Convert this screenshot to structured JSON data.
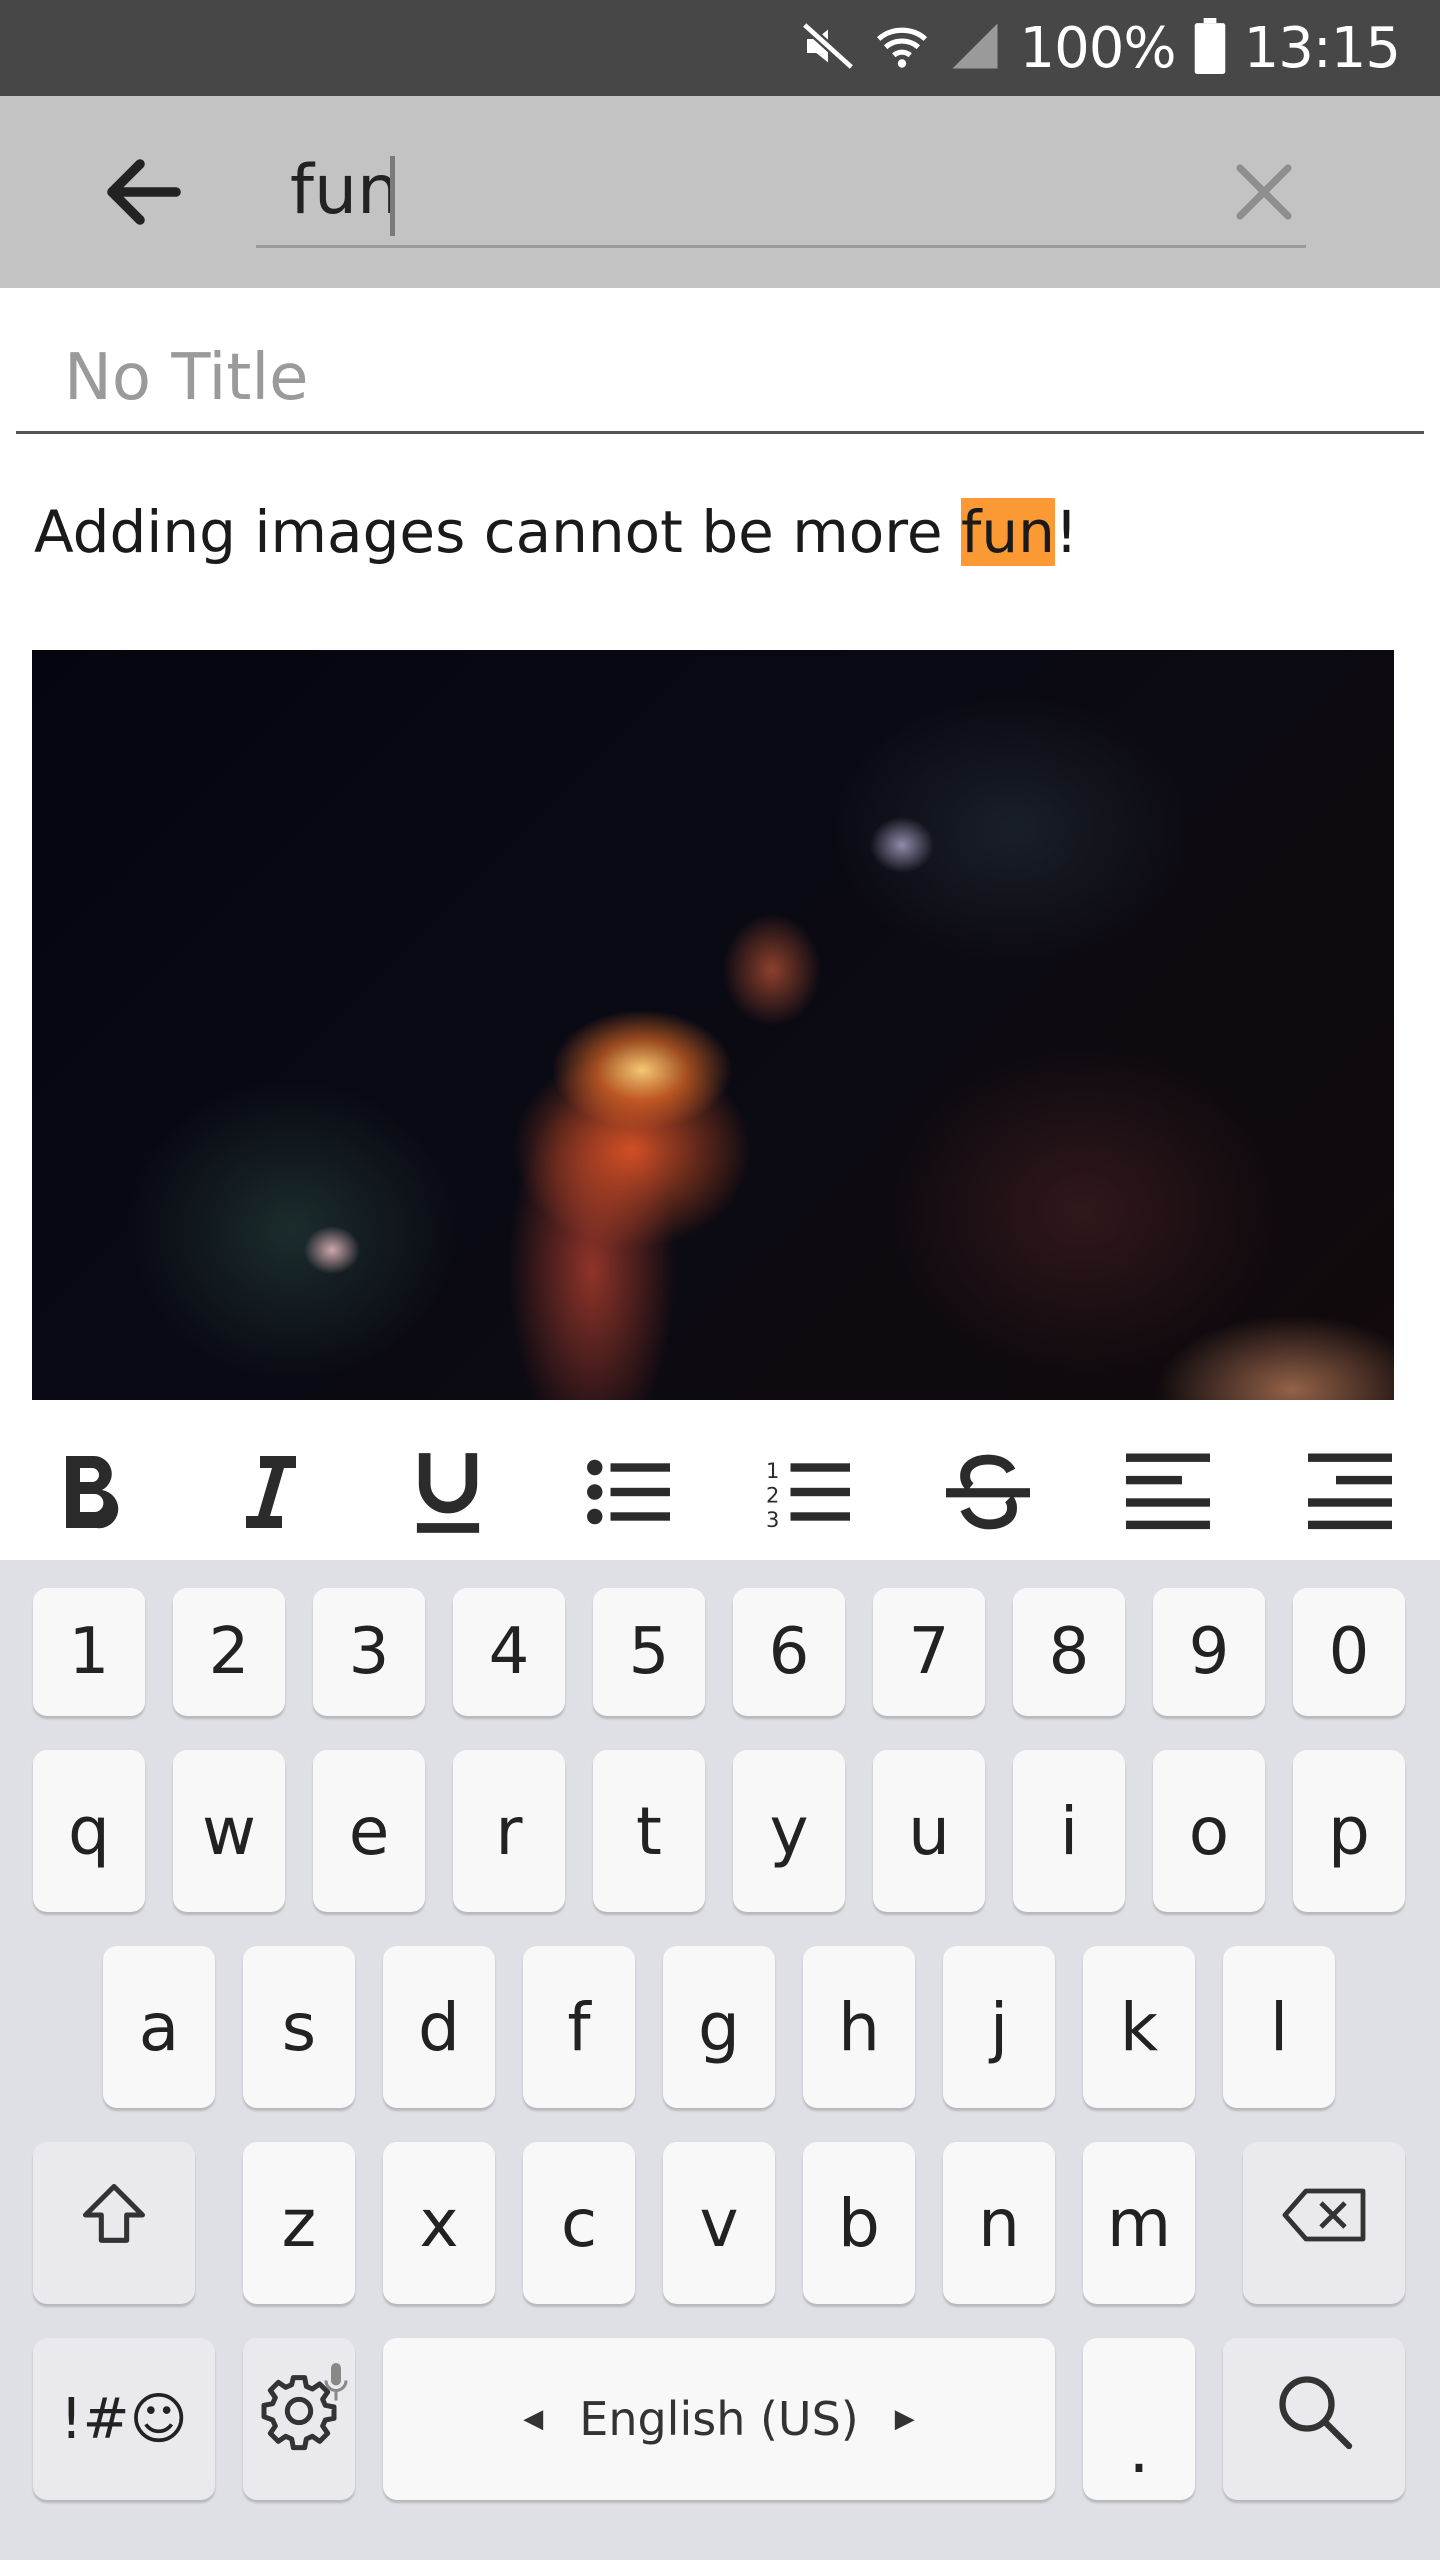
{
  "status_bar": {
    "battery": "100%",
    "time": "13:15"
  },
  "search": {
    "query": "fun"
  },
  "note": {
    "title_placeholder": "No Title",
    "body_before": "Adding images cannot be more ",
    "body_highlight": "fun",
    "body_after": "!"
  },
  "toolbar": [
    "bold-icon",
    "italic-icon",
    "underline-icon",
    "bullet-list-icon",
    "numbered-list-icon",
    "strikethrough-icon",
    "align-left-icon",
    "align-right-icon"
  ],
  "keyboard": {
    "row_numbers": [
      "1",
      "2",
      "3",
      "4",
      "5",
      "6",
      "7",
      "8",
      "9",
      "0"
    ],
    "row_top": [
      "q",
      "w",
      "e",
      "r",
      "t",
      "y",
      "u",
      "i",
      "o",
      "p"
    ],
    "row_middle": [
      "a",
      "s",
      "d",
      "f",
      "g",
      "h",
      "j",
      "k",
      "l"
    ],
    "row_bottom": [
      "z",
      "x",
      "c",
      "v",
      "b",
      "n",
      "m"
    ],
    "symbols_label": "!#☺",
    "space_label": "English (US)",
    "period": "."
  },
  "colors": {
    "status_bar": "#474747",
    "search_bar": "#c4c3c4",
    "highlight": "#fb9a35",
    "keyboard_bg": "#dfe0e5"
  }
}
